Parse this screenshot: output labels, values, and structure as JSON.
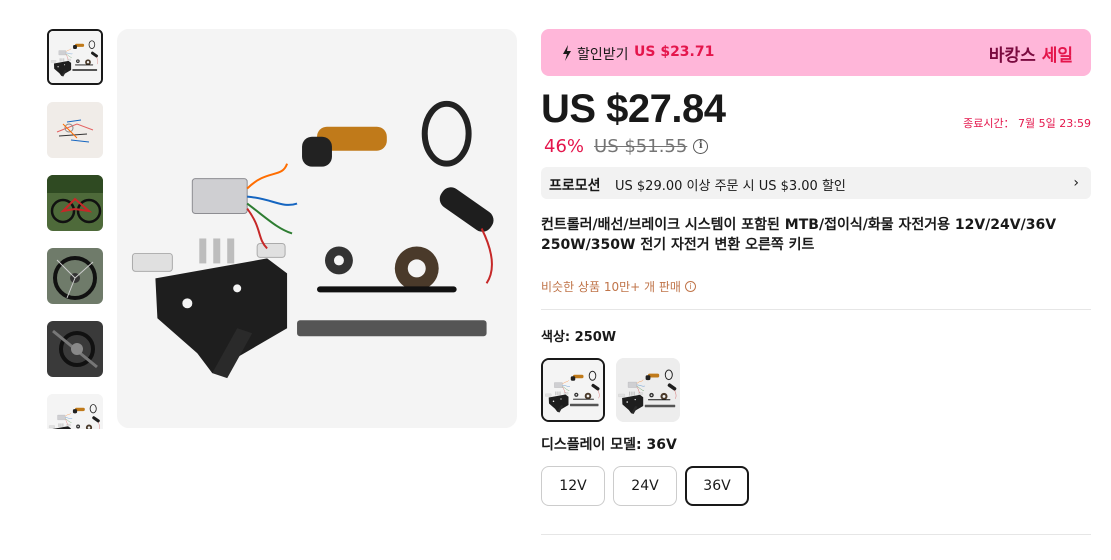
{
  "gallery": {
    "thumbnails": [
      {
        "name": "kit-parts",
        "active": true
      },
      {
        "name": "bike-side",
        "active": false
      },
      {
        "name": "bike-mountain",
        "active": false
      },
      {
        "name": "bike-wheel",
        "active": false
      },
      {
        "name": "bike-closeup",
        "active": false
      },
      {
        "name": "kit-parts-alt",
        "active": false
      }
    ]
  },
  "banner": {
    "coupon_label": "할인받기",
    "coupon_amount": "US $23.71",
    "sale_tag_a": "바캉스",
    "sale_tag_b": "세일",
    "icon": "bolt-icon"
  },
  "pricing": {
    "price": "US $27.84",
    "discount": "46%",
    "original_price": "US $51.55",
    "end_time": "종료시간： 7월 5일 23:59"
  },
  "promotion": {
    "title": "프로모션",
    "text": "US $29.00 이상 주문 시 US $3.00 할인"
  },
  "product": {
    "title": "컨트롤러/배선/브레이크 시스템이 포함된 MTB/접이식/화물 자전거용 12V/24V/36V 250W/350W 전기 자전거 변환 오른쪽 키트",
    "sold": "비슷한 상품 10만+ 개 판매"
  },
  "color": {
    "label": "색상: 250W",
    "selected_index": 0
  },
  "display_model": {
    "label": "디스플레이 모델: 36V",
    "options": [
      "12V",
      "24V",
      "36V"
    ],
    "selected_index": 2
  },
  "colors": {
    "accent": "#e4164c",
    "banner_bg": "#ffb6d9",
    "sold_text": "#c0754a"
  }
}
